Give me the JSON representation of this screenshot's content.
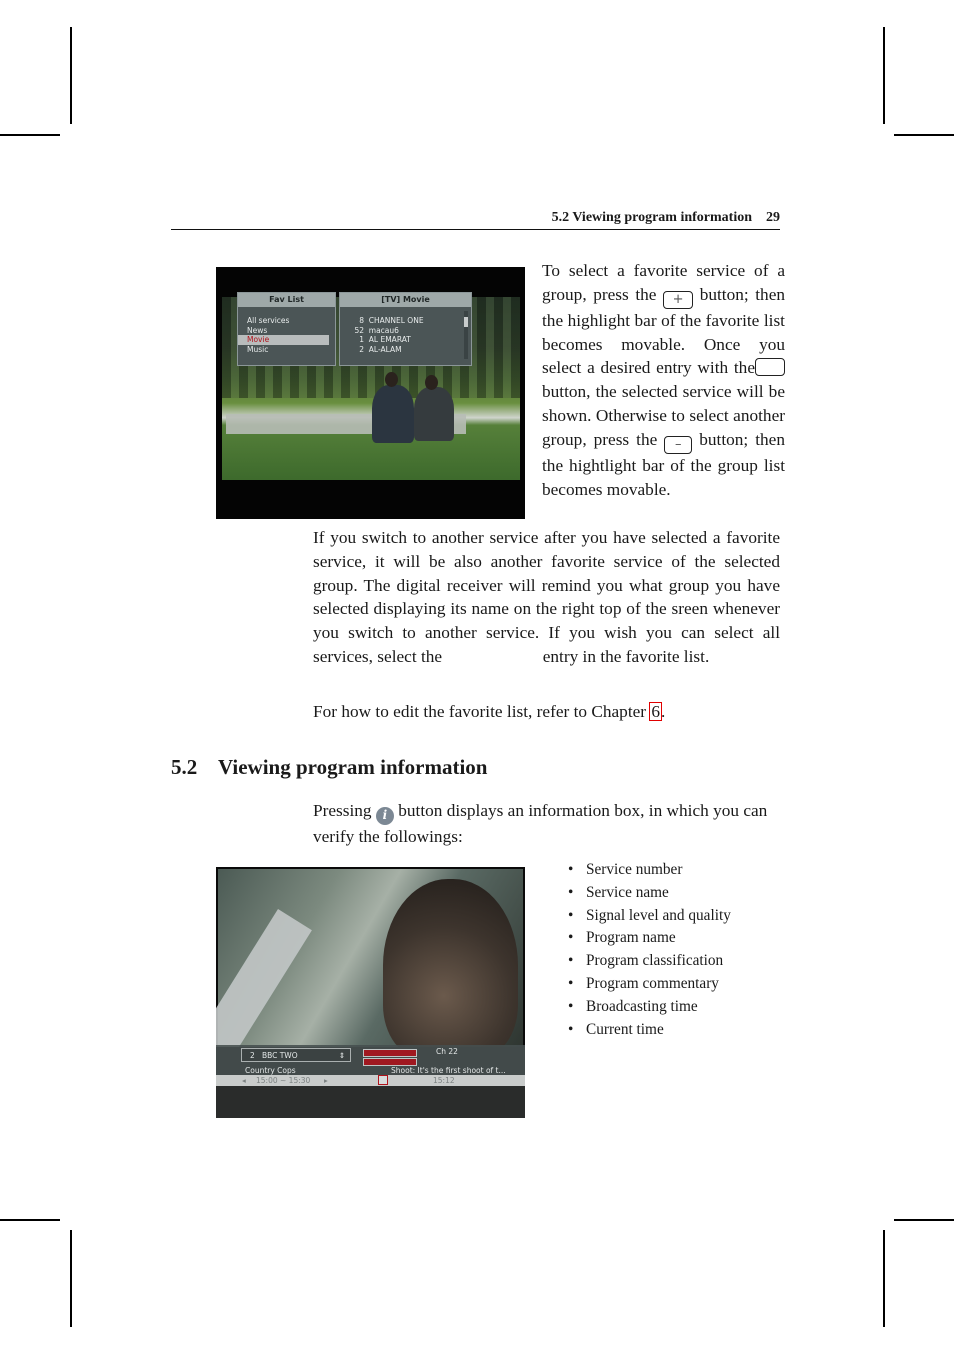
{
  "running_head": {
    "section_title": "5.2 Viewing program information",
    "page_number": "29"
  },
  "figure1": {
    "fav_list": {
      "title": "Fav List",
      "items": [
        "All services",
        "News",
        "Movie",
        "Music"
      ],
      "selected": "Movie"
    },
    "service_list": {
      "title": "[TV] Movie",
      "items": [
        {
          "number": "8",
          "name": "CHANNEL ONE"
        },
        {
          "number": "52",
          "name": "macau6"
        },
        {
          "number": "1",
          "name": "AL EMARAT"
        },
        {
          "number": "2",
          "name": "AL-ALAM"
        }
      ]
    },
    "colors": {
      "highlight_text": "#b0121b",
      "panel_bg": "#4b5556",
      "panel_title": "#9ea8a8"
    }
  },
  "side_paragraph": {
    "part1": "To select a favorite service of a group, press the",
    "key_plus": "+",
    "part2": "button; then the highlight bar of the favorite list becomes movable. Once you select a desired entry with the",
    "key_ok": "",
    "part3": "button, the selected service will be shown. Otherwise to select another group, press the",
    "key_minus": "–",
    "part4": "button; then the hightlight bar of the group list becomes movable."
  },
  "main_paragraph": {
    "part1": "If you switch to another service after you have selected a favorite service, it will be also another favorite service of the selected group. The digital receiver will remind you what group you have selected displaying its name on the right top of the sreen whenever you switch to another service. If you wish you can select all services, select the",
    "part2": "entry in the favorite list."
  },
  "chapter_paragraph": {
    "text": "For how to edit the favorite list, refer to Chapter",
    "link": "6",
    "tail": "."
  },
  "section": {
    "number": "5.2",
    "title": "Viewing program information"
  },
  "info_paragraph": {
    "part1": "Pressing",
    "icon": "i",
    "part2": "button displays an information box, in which you can verify the followings:"
  },
  "bullets": [
    "Service number",
    "Service name",
    "Signal level and quality",
    "Program name",
    "Program classification",
    "Program commentary",
    "Broadcasting time",
    "Current time"
  ],
  "figure2": {
    "service_number": "2",
    "service_name": "BBC TWO",
    "channel": "Ch 22",
    "program_name": "Country Cops",
    "program_commentary": "Shoot: It's the first shoot of t...",
    "broadcast_time": "15:00 ~ 15:30",
    "current_time": "15:12",
    "nav_prev": "◂",
    "nav_next": "▸",
    "selector_arrows": "⇕",
    "colors": {
      "signal_bar": "#a01820",
      "osd_bg": "#464e4e"
    }
  }
}
